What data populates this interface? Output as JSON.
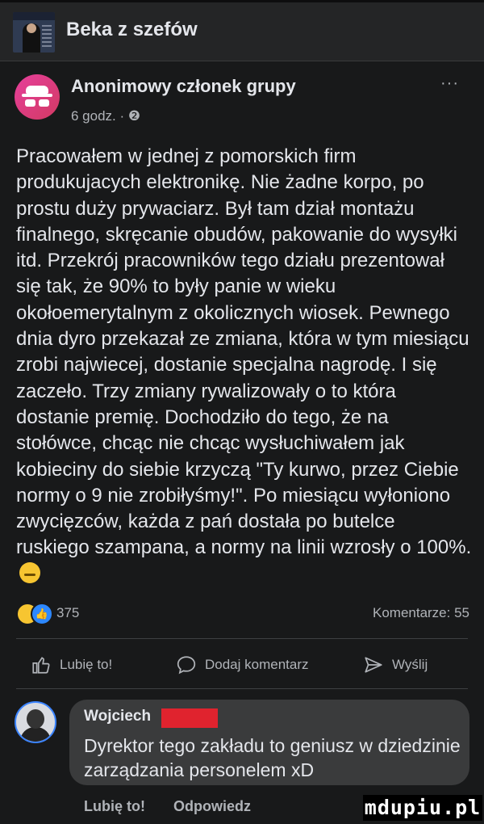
{
  "group": {
    "title": "Beka z szefów"
  },
  "post": {
    "author": "Anonimowy członek grupy",
    "time": "6 godz. · ❷",
    "more": "···",
    "body": "Pracowałem w jednej z pomorskich firm produkujacych elektronikę. Nie żadne korpo, po prostu duży prywaciarz. Był tam dział montażu finalnego, skręcanie obudów, pakowanie do wysyłki itd. Przekrój pracowników tego działu prezentował się tak, że 90% to były panie w wieku okołoemerytalnym z okolicznych wiosek. Pewnego dnia dyro przekazał ze zmiana, która w tym miesiącu zrobi najwiecej, dostanie specjalna nagrodę. I się zaczeło. Trzy zmiany rywalizowały o to która dostanie premię. Dochodziło do tego, że na stołówce, chcąc nie chcąc wysłuchiwałem jak kobieciny do siebie krzyczą \"Ty kurwo, przez Ciebie normy o 9 nie zrobiłyśmy!\". Po miesiącu wyłoniono zwycięzców, każda z pań dostała po butelce ruskiego szampana, a normy na linii wzrosły o 100%.",
    "reactions_count": "375",
    "comments_label": "Komentarze: 55",
    "reaction_icons": [
      "haha-icon",
      "like-icon"
    ]
  },
  "actions": {
    "like": "Lubię to!",
    "comment": "Dodaj komentarz",
    "share": "Wyślij"
  },
  "comment": {
    "author": "Wojciech",
    "text": "Dyrektor tego zakładu to geniusz w dziedzinie zarządzania personelem xD",
    "like": "Lubię to!",
    "reply": "Odpowiedz"
  },
  "watermark": "mdupiu.pl",
  "colors": {
    "background": "#18191a",
    "bubble": "#3a3b3c",
    "censor": "#e0232e",
    "like_blue": "#2d88ff"
  }
}
